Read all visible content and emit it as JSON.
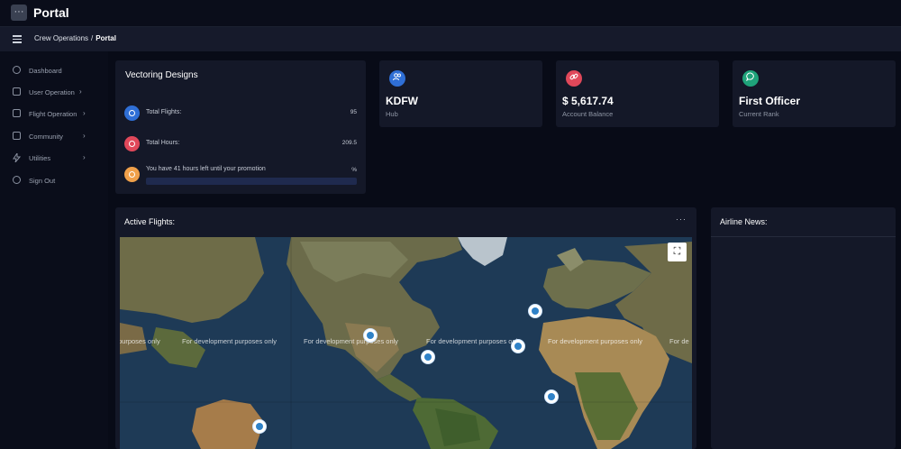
{
  "app": {
    "icon": "grid-icon",
    "title": "Portal"
  },
  "breadcrumb": {
    "section": "Crew Operations",
    "separator": "/",
    "current": "Portal"
  },
  "sidebar": {
    "items": [
      {
        "label": "Dashboard",
        "icon": "target-icon",
        "has_chevron": false
      },
      {
        "label": "User Operation",
        "icon": "gear-icon",
        "has_chevron": true
      },
      {
        "label": "Flight Operation",
        "icon": "gear-icon",
        "has_chevron": true
      },
      {
        "label": "Community",
        "icon": "cube-icon",
        "has_chevron": true
      },
      {
        "label": "Utilities",
        "icon": "bolt-icon",
        "has_chevron": true
      },
      {
        "label": "Sign Out",
        "icon": "target-icon",
        "has_chevron": false
      }
    ],
    "chevron": "›"
  },
  "vectoring": {
    "title": "Vectoring Designs",
    "rows": [
      {
        "label": "Total Flights:",
        "value": "95",
        "color": "#2f6fd6"
      },
      {
        "label": "Total Hours:",
        "value": "209.5",
        "color": "#e0485a"
      },
      {
        "label": "You have 41 hours left until your promotion",
        "value": "%",
        "color": "#f0a04a",
        "progress": 0
      }
    ]
  },
  "stats": [
    {
      "icon": "users-icon",
      "glyph": "👥",
      "value": "KDFW",
      "label": "Hub",
      "color": "#2f6fd6"
    },
    {
      "icon": "link-icon",
      "glyph": "🔗",
      "value": "$ 5,617.74",
      "label": "Account Balance",
      "color": "#e0485a"
    },
    {
      "icon": "chat-icon",
      "glyph": "💬",
      "value": "First Officer",
      "label": "Current Rank",
      "color": "#1fa37a"
    }
  ],
  "active_flights": {
    "title": "Active Flights:",
    "menu": "···",
    "fullscreen_icon": "⛶",
    "watermark": "For development purposes only",
    "watermark_repeat_labels": [
      "purposes only",
      "For development purposes only",
      "For development purposes only",
      "For development purposes only",
      "For development purposes only",
      "For de"
    ],
    "flights": [
      {
        "name": "flight-1"
      },
      {
        "name": "flight-2"
      },
      {
        "name": "flight-3"
      },
      {
        "name": "flight-4"
      },
      {
        "name": "flight-5"
      },
      {
        "name": "flight-6"
      }
    ]
  },
  "news": {
    "title": "Airline News:"
  },
  "colors": {
    "background": "#080b17",
    "card": "#141828",
    "accent_blue": "#2f6fd6",
    "accent_red": "#e0485a",
    "accent_orange": "#f0a04a",
    "accent_green": "#1fa37a"
  }
}
